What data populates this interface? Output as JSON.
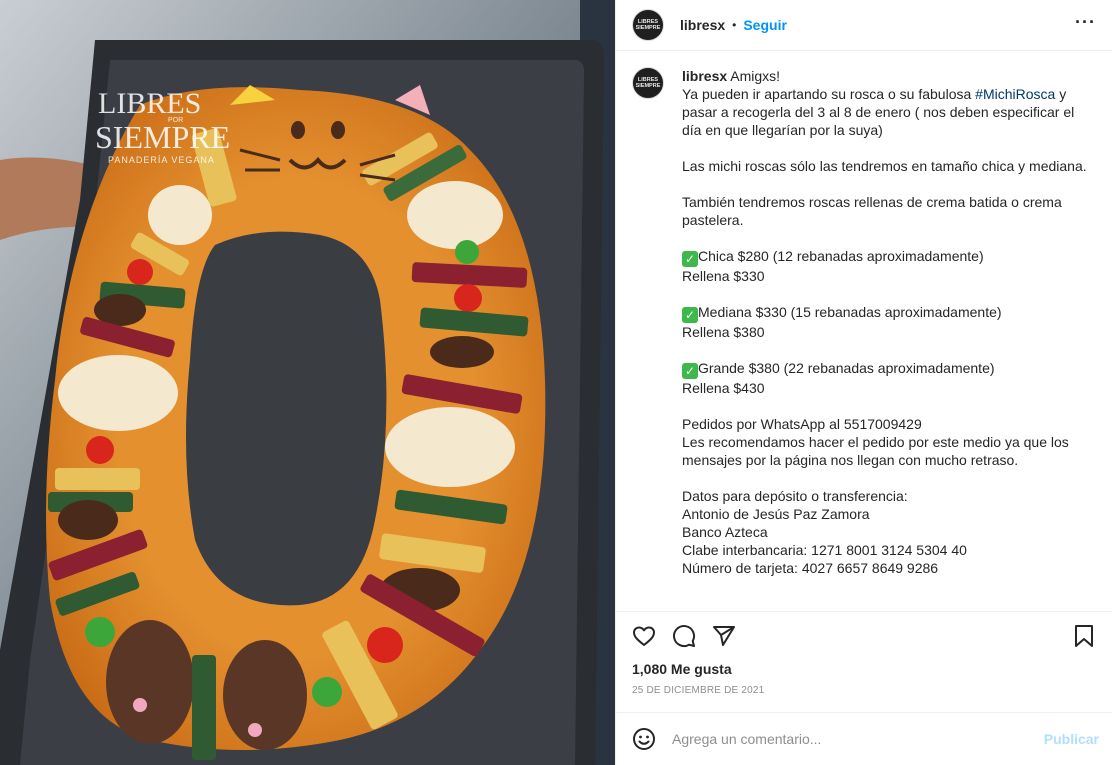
{
  "post": {
    "media": {
      "watermark_line1": "LIBRES",
      "watermark_line2": "SIEMPRE",
      "watermark_small": "POR",
      "watermark_sub": "PANADERÍA VEGANA"
    },
    "header": {
      "username": "libresx",
      "separator": "•",
      "follow_label": "Seguir",
      "more_label": "···",
      "avatar_text_1": "LIBRES",
      "avatar_text_2": "SIEMPRE"
    },
    "caption": {
      "username": "libresx",
      "intro": " Amigxs!\nYa pueden ir apartando su rosca o su fabulosa ",
      "hashtag": "#MichiRosca",
      "paragraph1_end": " y pasar a recogerla del 3 al 8 de enero ( nos deben especificar el día en que llegarían por la suya)",
      "paragraph2": "Las michi roscas sólo las tendremos en tamaño chica y mediana.",
      "paragraph3": "También tendremos roscas rellenas de crema batida o crema pastelera.",
      "sizes": [
        {
          "check": "✓",
          "line1": "Chica $280 (12 rebanadas aproximadamente)",
          "line2": "Rellena $330"
        },
        {
          "check": "✓",
          "line1": "Mediana $330 (15 rebanadas aproximadamente)",
          "line2": "Rellena $380"
        },
        {
          "check": "✓",
          "line1": "Grande $380 (22 rebanadas aproximadamente)",
          "line2": "Rellena $430"
        }
      ],
      "orders": "Pedidos por WhatsApp al 5517009429\nLes recomendamos hacer el pedido por este medio ya que los mensajes por la página nos llegan con mucho retraso.",
      "bank": "Datos para depósito o transferencia:\nAntonio de Jesús Paz Zamora\nBanco Azteca\nClabe interbancaria: 1271 8001 3124 5304 40\nNúmero de tarjeta: 4027 6657 8649 9286"
    },
    "actions": {
      "like_icon": "heart-icon",
      "comment_icon": "comment-icon",
      "share_icon": "paper-plane-icon",
      "save_icon": "bookmark-icon"
    },
    "likes": "1,080 Me gusta",
    "date": "25 DE DICIEMBRE DE 2021",
    "comment": {
      "placeholder": "Agrega un comentario...",
      "publish_label": "Publicar"
    },
    "colors": {
      "link_blue": "#0095f6",
      "hashtag": "#00376b",
      "publish_disabled": "#b2dffc",
      "muted": "#8e8e8e"
    }
  }
}
